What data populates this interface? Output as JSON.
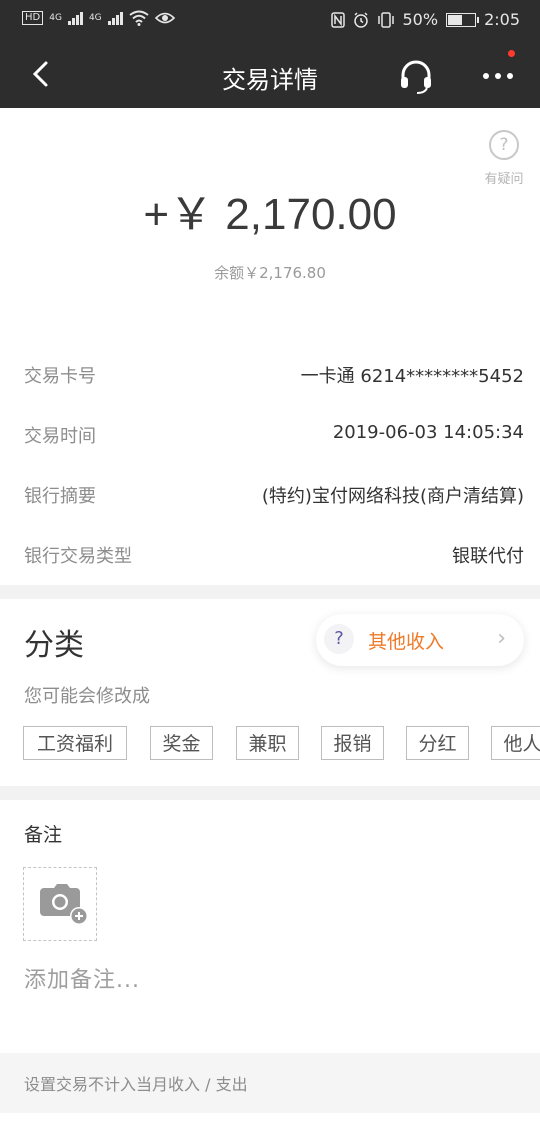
{
  "status_bar": {
    "hd_badge": "HD",
    "net1": "4G",
    "net2": "4G",
    "battery_percent": "50%",
    "time": "2:05"
  },
  "header": {
    "title": "交易详情",
    "back_icon": "chevron-left-icon",
    "service_icon": "headset-icon",
    "more_icon": "more-dots-icon",
    "badge_color": "#ff3b30"
  },
  "help": {
    "icon": "?",
    "label": "有疑问"
  },
  "transaction": {
    "amount": "+￥ 2,170.00",
    "balance": "余额￥2,176.80"
  },
  "details": [
    {
      "label": "交易卡号",
      "value": "一卡通 6214********5452"
    },
    {
      "label": "交易时间",
      "value": "2019-06-03 14:05:34"
    },
    {
      "label": "银行摘要",
      "value": "(特约)宝付网络科技(商户清结算)"
    },
    {
      "label": "银行交易类型",
      "value": "银联代付"
    }
  ],
  "category": {
    "title": "分类",
    "current_icon": "?",
    "current": "其他收入",
    "current_color": "#ef7a2a",
    "arrow": "›",
    "hint": "您可能会修改成",
    "suggestions": [
      "工资福利",
      "奖金",
      "兼职",
      "报销",
      "分红",
      "他人"
    ]
  },
  "note": {
    "title": "备注",
    "photo_icon": "camera-add-icon",
    "placeholder": "添加备注..."
  },
  "footer": {
    "text": "设置交易不计入当月收入 / 支出"
  }
}
